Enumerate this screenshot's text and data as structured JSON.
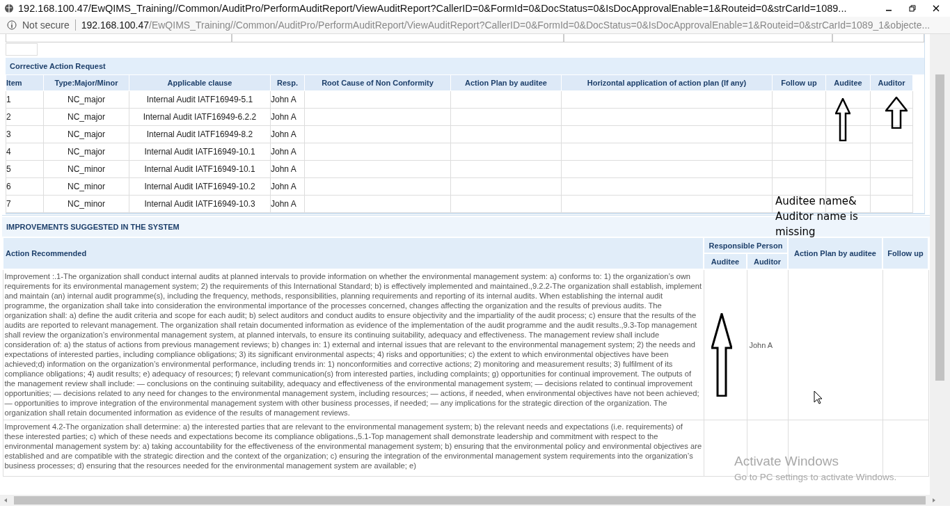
{
  "window": {
    "title": "192.168.100.47/EwQIMS_Training//Common/AuditPro/PerformAuditReport/ViewAuditReport?CallerID=0&FormId=0&DocStatus=0&IsDocApprovalEnable=1&Routeid=0&strCarId=1089..."
  },
  "address_bar": {
    "security": "Not secure",
    "host": "192.168.100.47",
    "path": "/EwQIMS_Training//Common/AuditPro/PerformAuditReport/ViewAuditReport?CallerID=0&FormId=0&DocStatus=0&IsDocApprovalEnable=1&Routeid=0&strCarId=1089_1&objecte..."
  },
  "corrective_action": {
    "title": "Corrective Action Request",
    "columns": [
      "Item",
      "Type:Major/Minor",
      "Applicable clause",
      "Resp.",
      "Root Cause of Non Conformity",
      "Action Plan by auditee",
      "Horizontal application of action plan (If any)",
      "Follow up",
      "Auditee",
      "Auditor"
    ],
    "rows": [
      {
        "item": "1",
        "type": "NC_major",
        "clause": "Internal Audit IATF16949-5.1",
        "resp": "John A"
      },
      {
        "item": "2",
        "type": "NC_major",
        "clause": "Internal Audit IATF16949-6.2.2",
        "resp": "John A"
      },
      {
        "item": "3",
        "type": "NC_major",
        "clause": "Internal Audit IATF16949-8.2",
        "resp": "John A"
      },
      {
        "item": "4",
        "type": "NC_major",
        "clause": "Internal Audit IATF16949-10.1",
        "resp": "John A"
      },
      {
        "item": "5",
        "type": "NC_minor",
        "clause": "Internal Audit IATF16949-10.1",
        "resp": "John A"
      },
      {
        "item": "6",
        "type": "NC_minor",
        "clause": "Internal Audit IATF16949-10.2",
        "resp": "John A"
      },
      {
        "item": "7",
        "type": "NC_minor",
        "clause": "Internal Audit IATF16949-10.3",
        "resp": "John A"
      }
    ]
  },
  "improvements": {
    "title": "IMPROVEMENTS SUGGESTED IN THE SYSTEM",
    "action_header": "Action Recommended",
    "responsible_header": "Responsible Person",
    "auditee_header": "Auditee",
    "auditor_header": "Auditor",
    "plan_header": "Action Plan by auditee",
    "follow_header": "Follow up",
    "rows": [
      {
        "text": "Improvement :.1-The organization shall conduct internal audits at planned intervals to provide information on whether the environmental management system: a) conforms to: 1) the organization’s own requirements for its environmental management system; 2) the requirements of this International Standard; b) is effectively implemented and maintained.,9.2.2-The organization shall establish, implement and maintain (an) internal audit programme(s), including the frequency, methods, responsibilities, planning requirements and reporting of its internal audits. When establishing the internal audit programme, the organization shall take into consideration the environmental importance of the processes concerned, changes affecting the organization and the results of previous audits. The organization shall: a) define the audit criteria and scope for each audit; b) select auditors and conduct audits to ensure objectivity and the impartiality of the audit process; c) ensure that the results of the audits are reported to relevant management. The organization shall retain documented information as evidence of the implementation of the audit programme and the audit results.,9.3-Top management shall review the organization’s environmental management system, at planned intervals, to ensure its continuing suitability, adequacy and effectiveness. The management review shall include consideration of: a) the status of actions from previous management reviews; b) changes in: 1) external and internal issues that are relevant to the environmental management system; 2) the needs and expectations of interested parties, including compliance obligations; 3) its significant environmental aspects; 4) risks and opportunities; c) the extent to which environmental objectives have been achieved;d) information on the organization’s environmental performance, including trends in: 1) nonconformities and corrective actions; 2) monitoring and measurement results; 3) fulfilment of its compliance obligations; 4) audit results; e) adequacy of resources; f) relevant communication(s) from interested parties, including complaints; g) opportunities for continual improvement. The outputs of the management review shall include: — conclusions on the continuing suitability, adequacy and effectiveness of the environmental management system; — decisions related to continual improvement opportunities; — decisions related to any need for changes to the environmental management system, including resources; — actions, if needed, when environmental objectives have not been achieved; — opportunities to improve integration of the environmental management system with other business processes, if needed; — any implications for the strategic direction of the organization. The organization shall retain documented information as evidence of the results of management reviews.",
        "auditor": "John A"
      },
      {
        "text": "Improvement 4.2-The organization shall determine: a) the interested parties that are relevant to the environmental management system; b) the relevant needs and expectations (i.e. requirements) of these interested parties; c) which of these needs and expectations become its compliance obligations.,5.1-Top management shall demonstrate leadership and commitment with respect to the environmental management system by: a) taking accountability for the effectiveness of the environmental management system; b) ensuring that the environmental policy and environmental objectives are established and are compatible with the strategic direction and the context of the organization; c) ensuring the integration of the environmental management system requirements into the organization’s business processes; d) ensuring that the resources needed for the environmental management system are available; e)",
        "auditor": ""
      }
    ]
  },
  "annotation": {
    "note": "Auditee name& Auditor name is missing"
  },
  "watermark": {
    "title": "Activate Windows",
    "subtitle": "Go to PC settings to activate Windows."
  }
}
